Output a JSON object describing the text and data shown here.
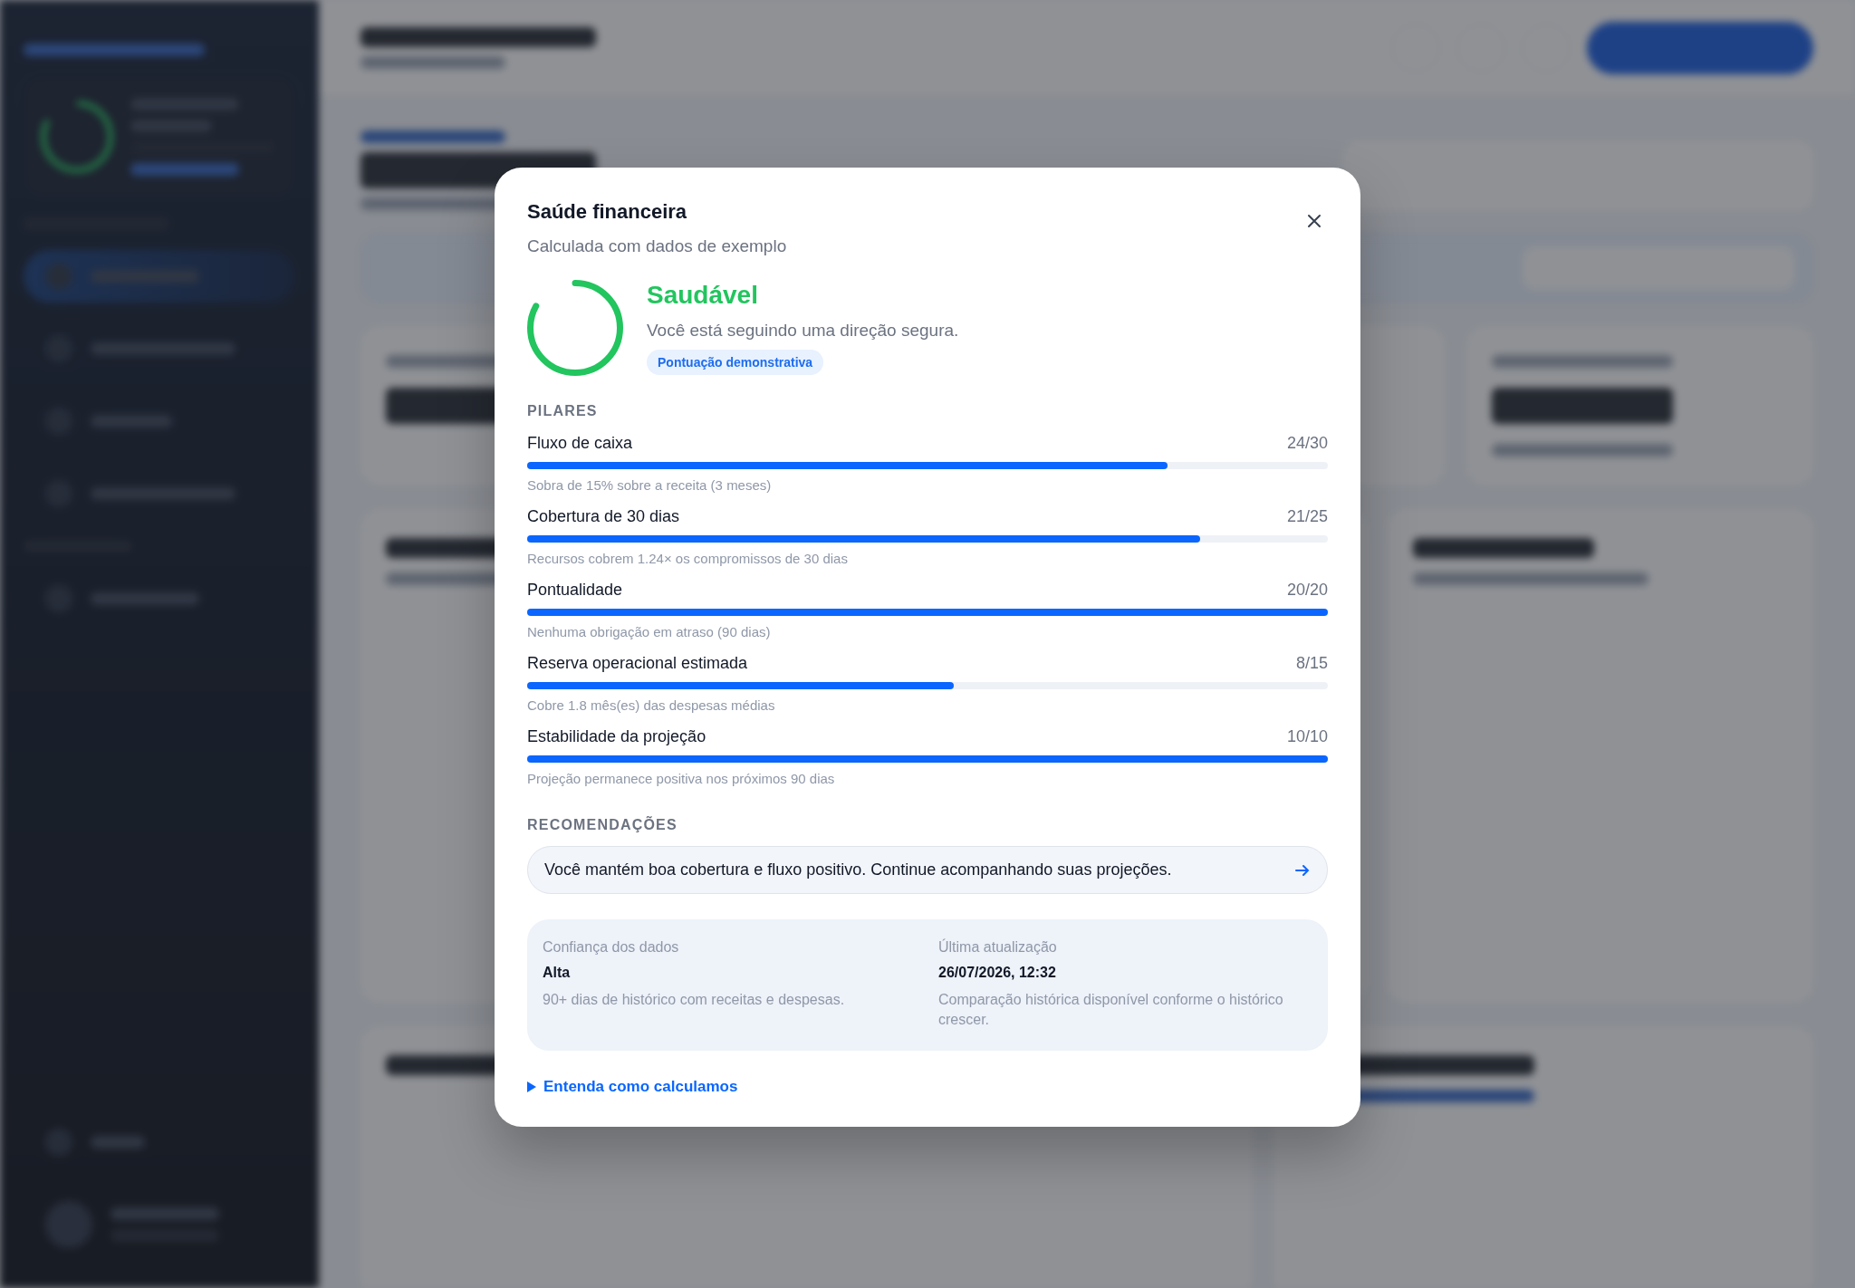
{
  "modal": {
    "title": "Saúde financeira",
    "subtitle": "Calculada com dados de exemplo",
    "score": {
      "level": 0.83,
      "status": "Saudável",
      "message": "Você está seguindo uma direção segura.",
      "badge": "Pontuação demonstrativa"
    },
    "pillars_title": "PILARES",
    "pillars": [
      {
        "name": "Fluxo de caixa",
        "score": "24/30",
        "level": 0.8,
        "detail": "Sobra de 15% sobre a receita (3 meses)"
      },
      {
        "name": "Cobertura de 30 dias",
        "score": "21/25",
        "level": 0.84,
        "detail": "Recursos cobrem 1.24× os compromissos de 30 dias"
      },
      {
        "name": "Pontualidade",
        "score": "20/20",
        "level": 1,
        "detail": "Nenhuma obrigação em atraso (90 dias)"
      },
      {
        "name": "Reserva operacional estimada",
        "score": "8/15",
        "level": 0.533,
        "detail": "Cobre 1.8 mês(es) das despesas médias"
      },
      {
        "name": "Estabilidade da projeção",
        "score": "10/10",
        "level": 1,
        "detail": "Projeção permanece positiva nos próximos 90 dias"
      }
    ],
    "recommendations_title": "RECOMENDAÇÕES",
    "recommendations": [
      "Você mantém boa cobertura e fluxo positivo. Continue acompanhando suas projeções."
    ],
    "info": [
      {
        "label": "Confiança dos dados",
        "value": "Alta",
        "note": "90+ dias de histórico com receitas e despesas."
      },
      {
        "label": "Última atualização",
        "value": "26/07/2026, 12:32",
        "note": "Comparação histórica disponível conforme o histórico crescer."
      }
    ],
    "details_link": {
      "label": "Entenda como calculamos",
      "expanded": false
    }
  }
}
